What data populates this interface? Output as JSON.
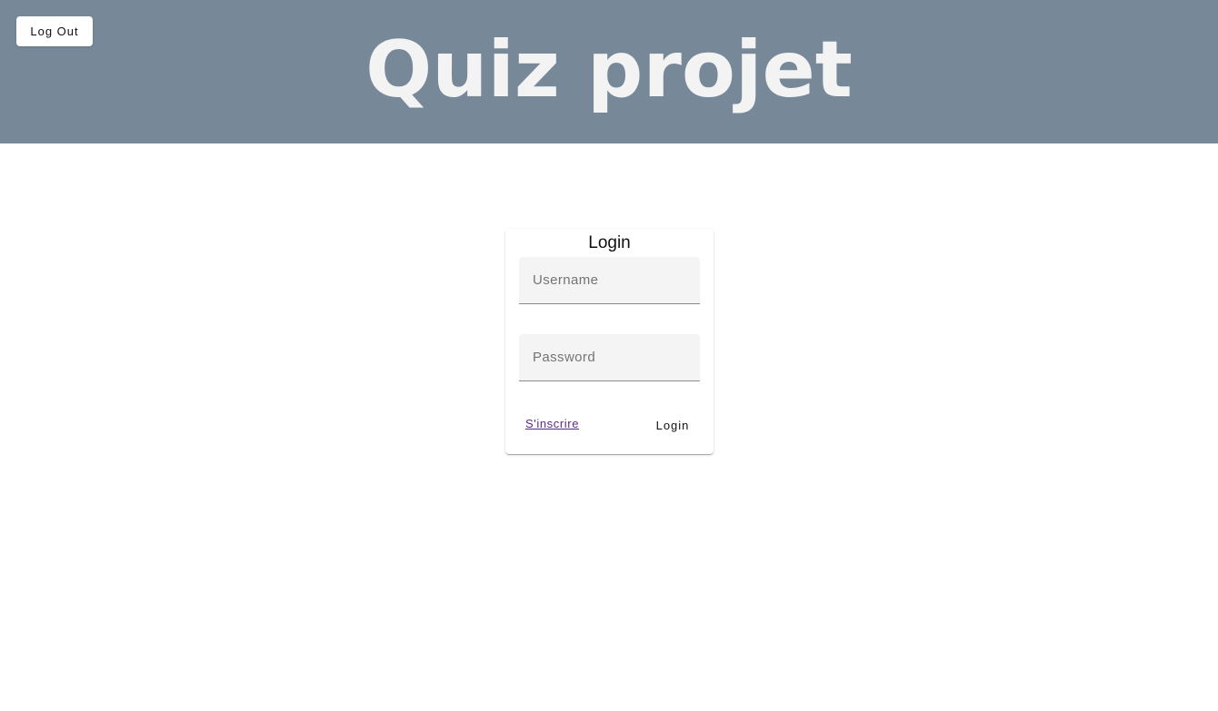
{
  "header": {
    "title": "Quiz projet",
    "logout_label": "Log Out",
    "background_color": "#778899"
  },
  "login": {
    "title": "Login",
    "username": {
      "placeholder": "Username",
      "value": ""
    },
    "password": {
      "placeholder": "Password",
      "value": ""
    },
    "signup_label": "S'inscrire",
    "submit_label": "Login",
    "link_color": "#5c2a86"
  }
}
